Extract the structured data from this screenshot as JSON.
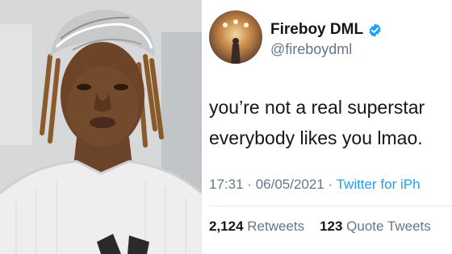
{
  "profile": {
    "display_name": "Fireboy DML",
    "handle": "@fireboydml",
    "verified_icon": "verified-badge-icon",
    "accent_color": "#1da1f2"
  },
  "tweet": {
    "line1": "you’re not a real superstar",
    "line2": "everybody likes you lmao."
  },
  "meta": {
    "time": "17:31",
    "separator": "·",
    "date": "06/05/2021",
    "source": "Twitter for iPh"
  },
  "stats": {
    "retweets_count": "2,124",
    "retweets_label": "Retweets",
    "quotes_count": "123",
    "quotes_label": "Quote Tweets"
  }
}
